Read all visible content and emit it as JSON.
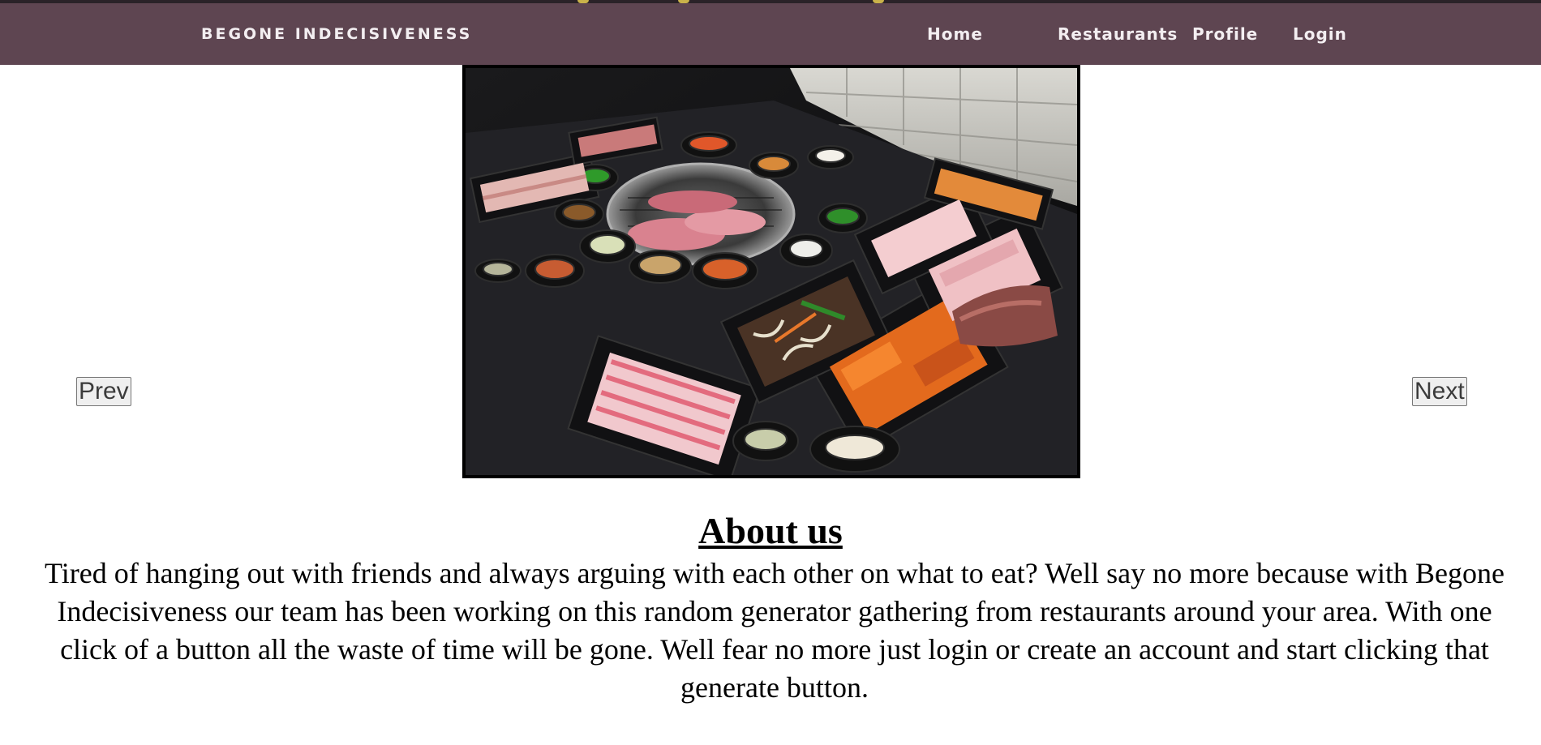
{
  "navbar": {
    "brand": "BEGONE INDECISIVENESS",
    "links": {
      "home": "Home",
      "restaurants": "Restaurants",
      "profile": "Profile",
      "login": "Login"
    },
    "background_color": "#5e4551",
    "text_color": "#f3eef1"
  },
  "carousel": {
    "prev_label": "Prev",
    "next_label": "Next"
  },
  "about": {
    "title": "About us",
    "body": "Tired of hanging out with friends and always arguing with each other on what to eat? Well say no more because with Begone Indecisiveness our team has been working on this random generator gathering from restaurants around your area. With one click of a button all the waste of time will be gone. Well fear no more just login or create an account and start clicking that generate button."
  }
}
